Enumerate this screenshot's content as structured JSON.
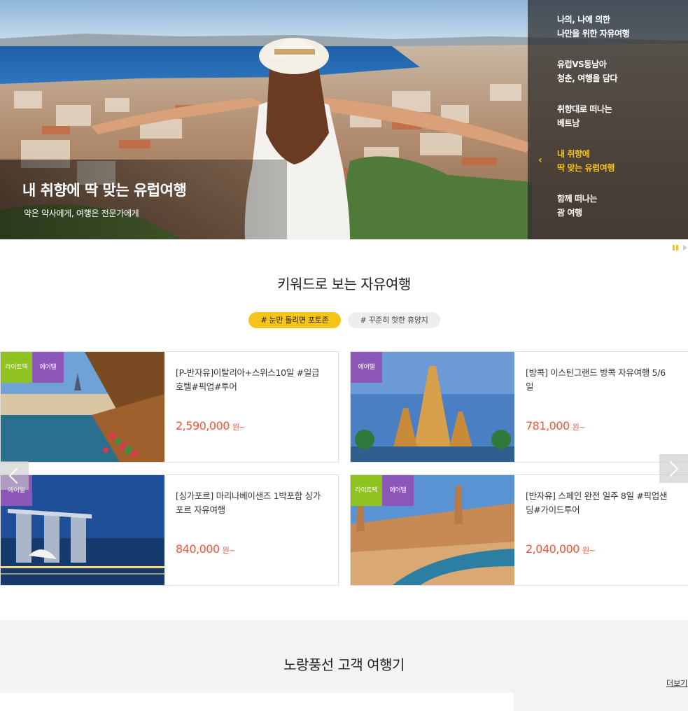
{
  "hero": {
    "title": "내 취향에 딱 맞는 유럽여행",
    "subtitle": "약은 약사에게, 여행은 전문가에게",
    "menu": [
      {
        "line1": "나의, 나에 의한",
        "line2": "나만을 위한 자유여행",
        "active": false
      },
      {
        "line1": "유럽VS동남아",
        "line2": "청춘, 여행을 담다",
        "active": false
      },
      {
        "line1": "취향대로 떠나는",
        "line2": "베트남",
        "active": false
      },
      {
        "line1": "내 취향에",
        "line2": "딱 맞는 유럽여행",
        "active": true
      },
      {
        "line1": "함께 떠나는",
        "line2": "괌 여행",
        "active": false
      }
    ],
    "arrow_glyph": "‹"
  },
  "keyword": {
    "title": "키워드로 보는 자유여행",
    "chips": [
      "# 눈만 돌리면 포토존",
      "# 꾸준히 핫한 휴양지"
    ],
    "cards": [
      {
        "badges": [
          "라이트텍",
          "에어텔"
        ],
        "title": "[P-반자유]이탈리아+스위스10일 #일급호텔#픽업#투어",
        "price": "2,590,000",
        "unit": "원~"
      },
      {
        "badges": [
          "에어텔"
        ],
        "title": "[방콕] 이스틴그랜드 방콕 자유여행 5/6일",
        "price": "781,000",
        "unit": "원~"
      },
      {
        "badges": [
          "에어텔"
        ],
        "title": "[싱가포르] 마리나베이샌즈 1박포함 싱가포르 자유여행",
        "price": "840,000",
        "unit": "원~"
      },
      {
        "badges": [
          "라이트텍",
          "에어텔"
        ],
        "title": "[반자유] 스페인 완전 일주 8일 #픽업샌딩#가이드투어",
        "price": "2,040,000",
        "unit": "원~"
      }
    ]
  },
  "review": {
    "title": "노랑풍선 고객 여행기",
    "more": "더보기"
  },
  "colors": {
    "accent": "#f5c418",
    "price": "#f0553a",
    "badge_light": "#8dc21f",
    "badge_air": "#8c57b8"
  }
}
